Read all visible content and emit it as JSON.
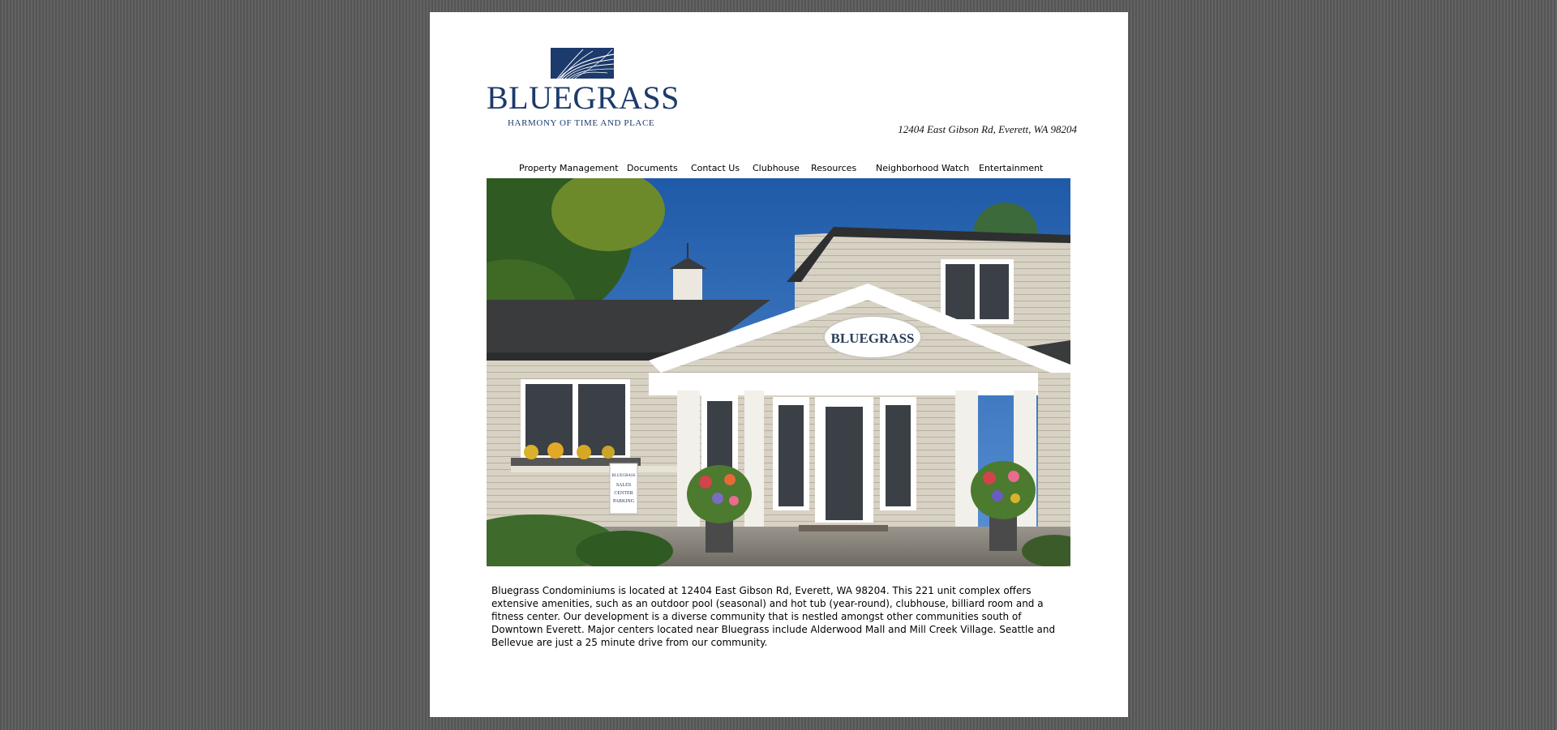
{
  "logo": {
    "wordmark": "BLUEGRASS",
    "tagline": "HARMONY OF TIME AND PLACE",
    "icon": "grass-icon",
    "brand_color": "#1c3a6b"
  },
  "address": "12404 East Gibson Rd, Everett, WA 98204",
  "nav": {
    "items": [
      {
        "label": "Property Management"
      },
      {
        "label": "Documents"
      },
      {
        "label": "Contact Us"
      },
      {
        "label": "Clubhouse"
      },
      {
        "label": "Resources"
      },
      {
        "label": "Neighborhood Watch"
      },
      {
        "label": "Entertainment"
      }
    ]
  },
  "hero": {
    "sign_text": "BLUEGRASS",
    "parking_sign": [
      "BLUEGRASS",
      "SALES",
      "CENTER",
      "PARKING"
    ]
  },
  "description": "Bluegrass Condominiums is located at 12404 East Gibson Rd, Everett, WA 98204. This 221 unit complex offers extensive amenities, such as an outdoor pool (seasonal) and hot tub (year-round), clubhouse, billiard room and a fitness center. Our development is a diverse community that is nestled amongst other communities south of Downtown Everett. Major centers located near Bluegrass include Alderwood Mall and Mill Creek Village. Seattle and Bellevue are just a 25 minute drive from our community."
}
